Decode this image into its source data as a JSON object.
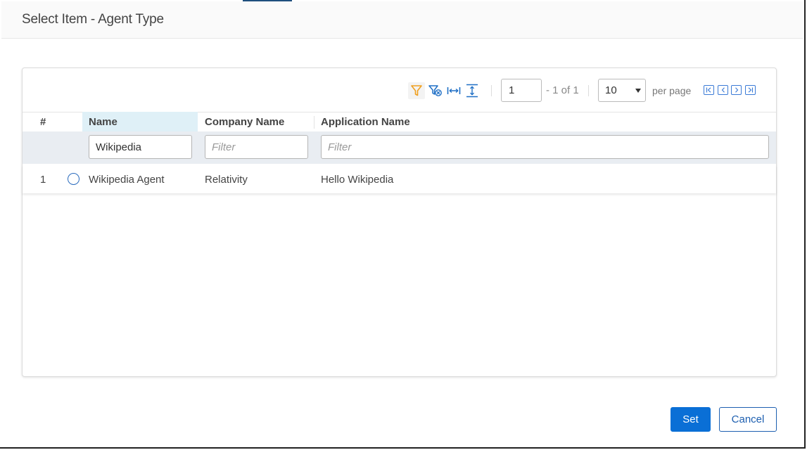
{
  "dialog": {
    "title": "Select Item - Agent Type"
  },
  "toolbar": {
    "icons": [
      "filter-icon",
      "clear-filter-icon",
      "fit-columns-icon",
      "expand-rows-icon"
    ],
    "page_value": "1",
    "page_of": "- 1 of 1",
    "per_page_value": "10",
    "per_page_label": "per page",
    "nav_icons": [
      "first-page-icon",
      "prev-page-icon",
      "next-page-icon",
      "last-page-icon"
    ]
  },
  "table": {
    "columns": [
      "#",
      "Name",
      "Company Name",
      "Application Name"
    ],
    "filters": {
      "name_value": "Wikipedia",
      "company_placeholder": "Filter",
      "application_placeholder": "Filter"
    },
    "rows": [
      {
        "num": "1",
        "name": "Wikipedia Agent",
        "company": "Relativity",
        "application": "Hello Wikipedia"
      }
    ]
  },
  "buttons": {
    "set": "Set",
    "cancel": "Cancel"
  },
  "colors": {
    "accent": "#0a6fd6",
    "filter_active": "#f0a020",
    "icon_blue": "#1f6fc5"
  }
}
